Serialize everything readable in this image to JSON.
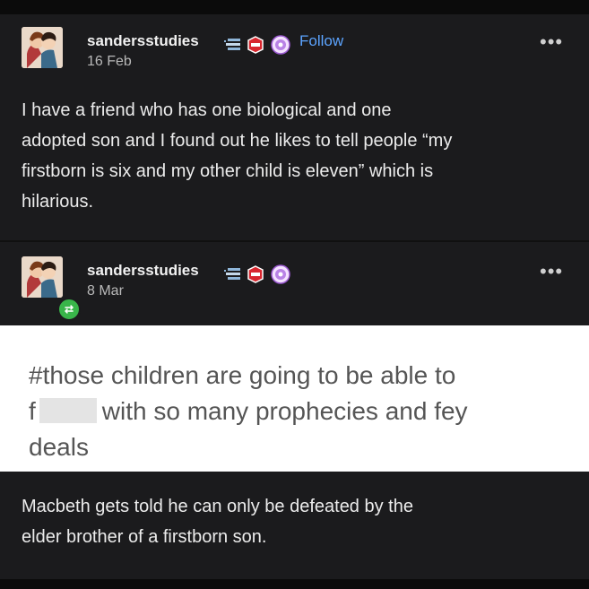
{
  "posts": [
    {
      "username": "sandersstudies",
      "date": "16 Feb",
      "follow_label": "Follow",
      "more": "•••",
      "text_lines": [
        "I have a friend who has one biological and one",
        "adopted son and I found out he likes to tell people “my",
        "firstborn is six and my other child is eleven” which is",
        "hilarious."
      ]
    },
    {
      "username": "sandersstudies",
      "date": "8 Mar",
      "more": "•••",
      "tags": {
        "line1": "#those children are going to be able to",
        "line2_start": "f",
        "line2_end": "with so many prophecies and fey",
        "line3": "deals"
      }
    },
    {
      "text_lines": [
        "Macbeth gets told he can only be defeated by the",
        "elder brother of a firstborn son."
      ]
    }
  ],
  "icons": {
    "badge_book": "book-stack-icon",
    "badge_red": "red-hexagon-badge-icon",
    "badge_purple": "purple-flower-badge-icon",
    "reblog": "reblog-icon"
  },
  "colors": {
    "follow": "#5ca4ff",
    "background": "#1b1b1d",
    "reblog": "#39b54a"
  }
}
